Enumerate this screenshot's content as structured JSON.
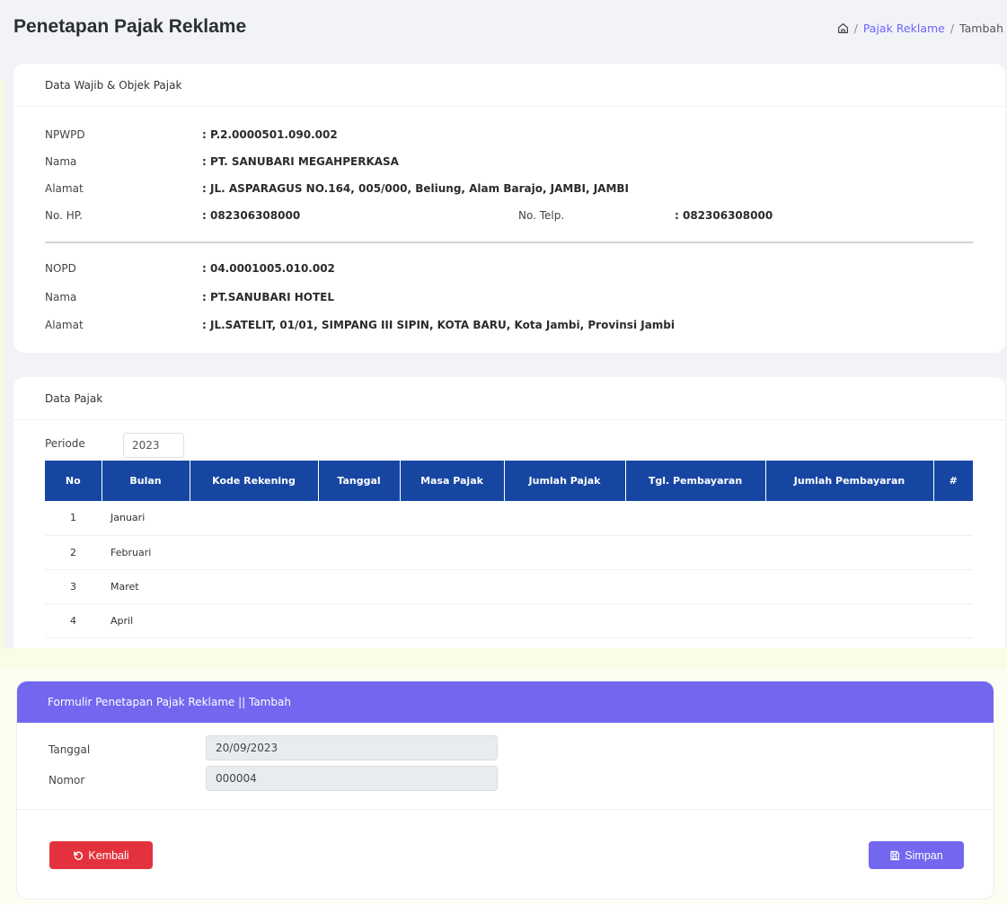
{
  "header": {
    "title": "Penetapan Pajak Reklame",
    "breadcrumb": [
      "Pajak Reklame",
      "Tambah"
    ]
  },
  "wajib_pajak": {
    "card_title": "Data Wajib & Objek Pajak",
    "npwpd_label": "NPWPD",
    "npwpd": ": P.2.0000501.090.002",
    "nama_label": "Nama",
    "nama": ": PT. SANUBARI MEGAHPERKASA",
    "alamat_label": "Alamat",
    "alamat": ": JL. ASPARAGUS NO.164, 005/000, Beliung, Alam Barajo, JAMBI, JAMBI",
    "hp_label": "No. HP.",
    "hp": ": 082306308000",
    "telp_label": "No. Telp.",
    "telp": ": 082306308000",
    "nopd_label": "NOPD",
    "nopd": ": 04.0001005.010.002",
    "objek_nama_label": "Nama",
    "objek_nama": ": PT.SANUBARI HOTEL",
    "objek_alamat_label": "Alamat",
    "objek_alamat": ": JL.SATELIT, 01/01, SIMPANG III SIPIN, KOTA BARU, Kota Jambi, Provinsi Jambi"
  },
  "data_pajak": {
    "card_title": "Data Pajak",
    "periode_label": "Periode",
    "periode_value": "2023",
    "columns": [
      "No",
      "Bulan",
      "Kode Rekening",
      "Tanggal",
      "Masa Pajak",
      "Jumlah Pajak",
      "Tgl. Pembayaran",
      "Jumlah Pembayaran",
      "#"
    ],
    "rows": [
      {
        "no": "1",
        "bulan": "Januari"
      },
      {
        "no": "2",
        "bulan": "Februari"
      },
      {
        "no": "3",
        "bulan": "Maret"
      },
      {
        "no": "4",
        "bulan": "April"
      }
    ]
  },
  "form": {
    "title": "Formulir Penetapan Pajak Reklame || Tambah",
    "tanggal_label": "Tanggal",
    "tanggal_value": "20/09/2023",
    "nomor_label": "Nomor",
    "nomor_value": "000004",
    "back_label": "Kembali",
    "save_label": "Simpan"
  },
  "colors": {
    "primary": "#7367f0",
    "table_header": "#1746a2",
    "danger": "#e3323d"
  },
  "icons": [
    "home-icon",
    "undo-icon",
    "save-icon"
  ]
}
